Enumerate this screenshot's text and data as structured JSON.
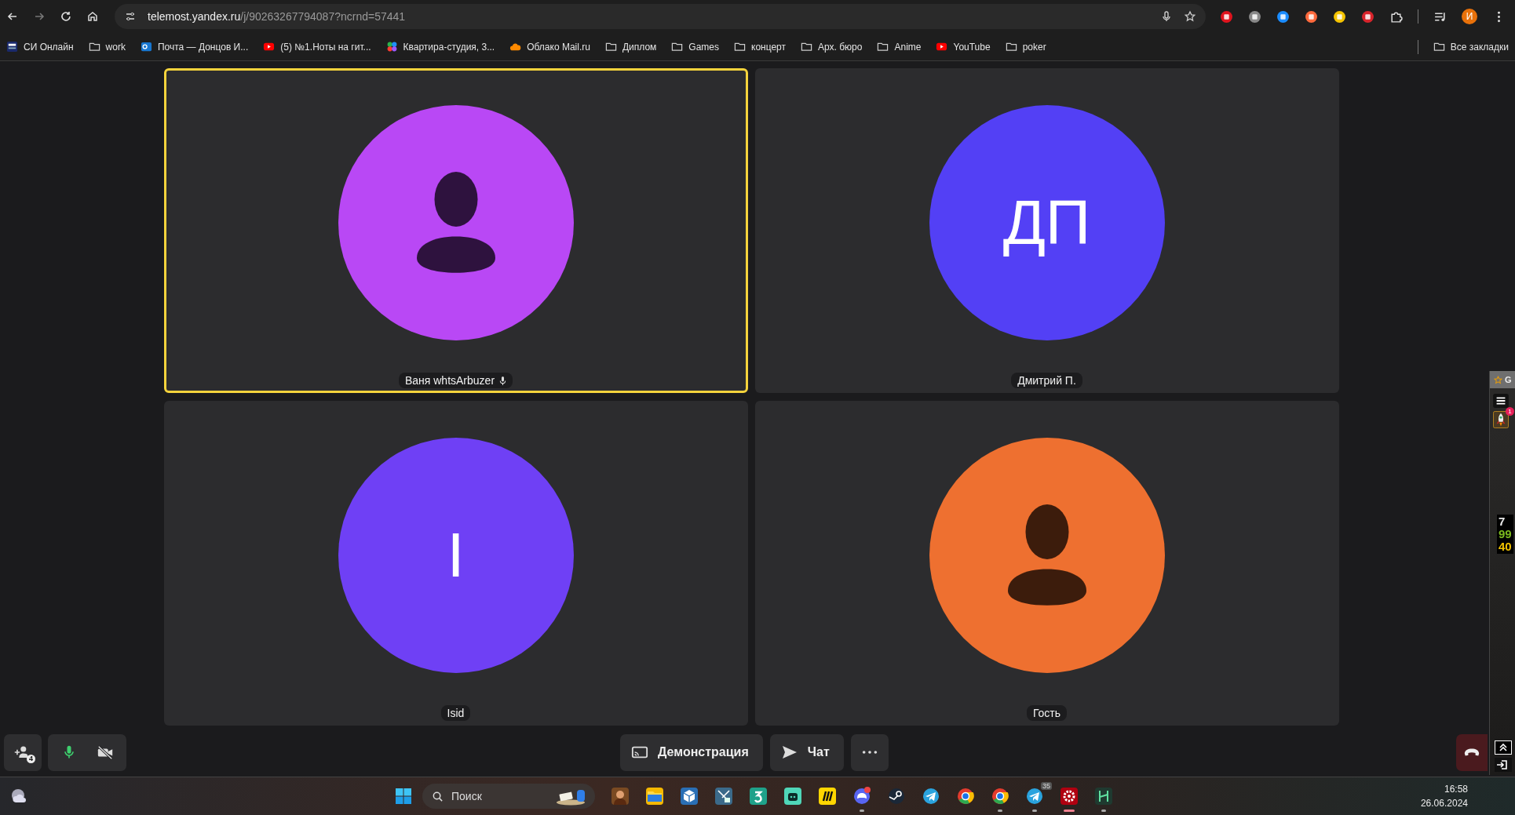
{
  "browser": {
    "url_host": "telemost.yandex.ru",
    "url_path": "/j/90263267794087?ncrnd=57441",
    "profile_initial": "И",
    "bookmarks": [
      {
        "label": "СИ Онлайн",
        "kind": "badge"
      },
      {
        "label": "work",
        "kind": "folder"
      },
      {
        "label": "Почта — Донцов И...",
        "kind": "mail"
      },
      {
        "label": "(5) №1.Ноты на гит...",
        "kind": "video"
      },
      {
        "label": "Квартира-студия, 3...",
        "kind": "dots"
      },
      {
        "label": "Облако Mail.ru",
        "kind": "cloud"
      },
      {
        "label": "Диплом",
        "kind": "folder"
      },
      {
        "label": "Games",
        "kind": "folder"
      },
      {
        "label": "концерт",
        "kind": "folder"
      },
      {
        "label": "Арх. бюро",
        "kind": "folder"
      },
      {
        "label": "Anime",
        "kind": "folder"
      },
      {
        "label": "YouTube",
        "kind": "video"
      },
      {
        "label": "poker",
        "kind": "folder"
      }
    ],
    "all_bookmarks": "Все закладки"
  },
  "participants": [
    {
      "name": "Ваня whtsArbuzer",
      "kind": "silhouette",
      "color": "#b948f5",
      "speaking": true,
      "mic_icon": true
    },
    {
      "name": "Дмитрий П.",
      "kind": "initials",
      "initials": "ДП",
      "color": "#5340f5",
      "speaking": false,
      "mic_icon": false
    },
    {
      "name": "Isid",
      "kind": "initials",
      "initials": "I",
      "color": "#6f40f5",
      "speaking": false,
      "mic_icon": false
    },
    {
      "name": "Гость",
      "kind": "silhouette",
      "color": "#ee7030",
      "speaking": false,
      "mic_icon": false
    }
  ],
  "controls": {
    "participant_count": "4",
    "mic_on": true,
    "camera_on": false,
    "share_label": "Демонстрация",
    "chat_label": "Чат"
  },
  "overlay": {
    "header": "G",
    "badge": "1",
    "counters": [
      {
        "value": "7",
        "color": "#e8e8e8"
      },
      {
        "value": "99",
        "color": "#7cbb1e"
      },
      {
        "value": "40",
        "color": "#f2c200"
      }
    ]
  },
  "taskbar": {
    "search_placeholder": "Поиск",
    "telegram_badge": "35",
    "time": "16:58",
    "date": "26.06.2024"
  }
}
